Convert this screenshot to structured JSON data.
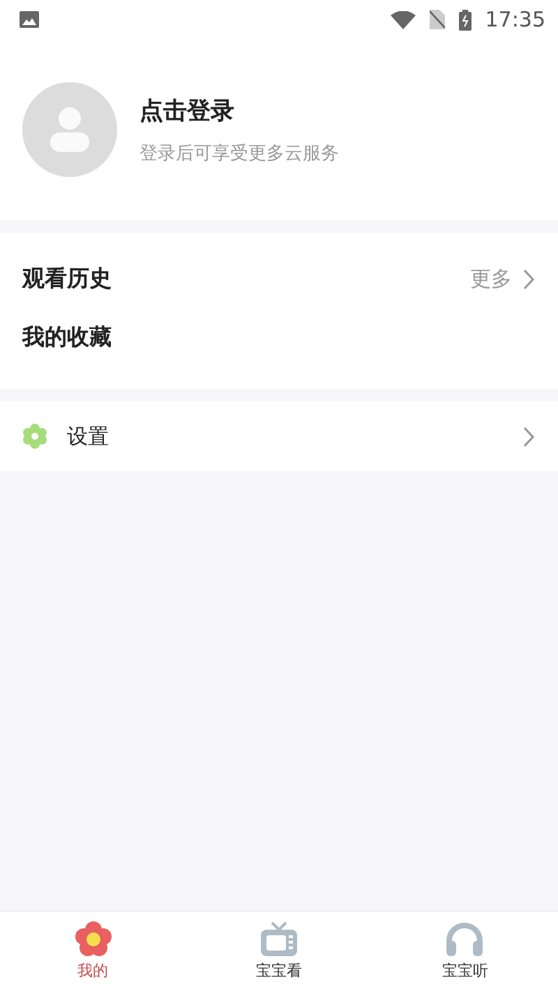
{
  "status_bar": {
    "time": "17:35"
  },
  "profile": {
    "title": "点击登录",
    "subtitle": "登录后可享受更多云服务"
  },
  "history": {
    "title": "观看历史",
    "more": "更多"
  },
  "favorites": {
    "title": "我的收藏"
  },
  "settings": {
    "label": "设置"
  },
  "tabs": [
    {
      "label": "我的",
      "kind": "flower",
      "selected": true
    },
    {
      "label": "宝宝看",
      "kind": "tv",
      "selected": false
    },
    {
      "label": "宝宝听",
      "kind": "headphones",
      "selected": false
    }
  ]
}
